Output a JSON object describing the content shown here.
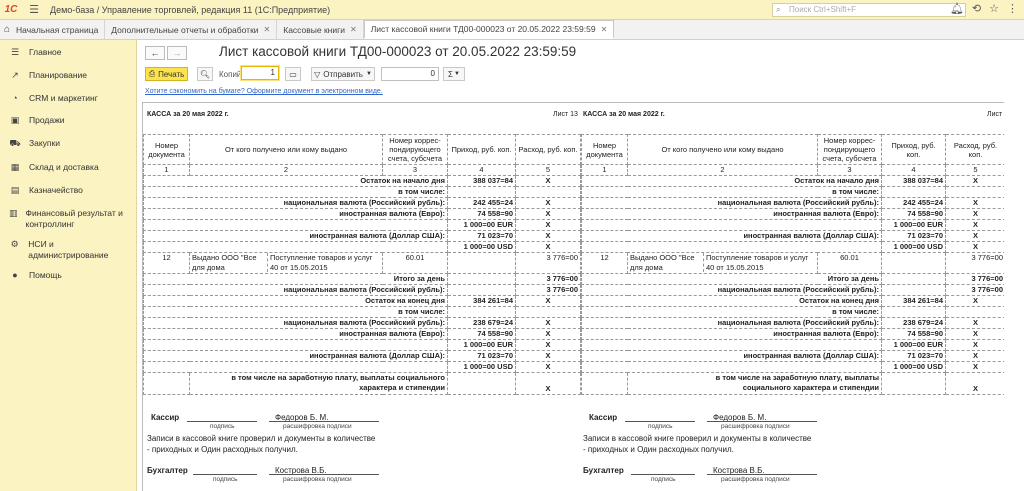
{
  "app": {
    "logo": "1С",
    "title": "Демо-база / Управление торговлей, редакция 11  (1С:Предприятие)",
    "search_placeholder": "Поиск Ctrl+Shift+F"
  },
  "tabs": [
    {
      "label": "Начальная страница"
    },
    {
      "label": "Дополнительные отчеты и обработки"
    },
    {
      "label": "Кассовые книги"
    },
    {
      "label": "Лист кассовой книги ТД00-000023 от 20.05.2022 23:59:59"
    }
  ],
  "sidebar": {
    "items": [
      {
        "label": "Главное",
        "icon": "menu-icon"
      },
      {
        "label": "Планирование",
        "icon": "chart-icon"
      },
      {
        "label": "CRM и маркетинг",
        "icon": "crm-icon"
      },
      {
        "label": "Продажи",
        "icon": "sales-icon"
      },
      {
        "label": "Закупки",
        "icon": "cart-icon"
      },
      {
        "label": "Склад и доставка",
        "icon": "warehouse-icon"
      },
      {
        "label": "Казначейство",
        "icon": "treasury-icon"
      },
      {
        "label": "Финансовый результат и контроллинг",
        "icon": "finance-icon"
      },
      {
        "label": "НСИ и администрирование",
        "icon": "gear-icon"
      },
      {
        "label": "Помощь",
        "icon": "help-icon"
      }
    ]
  },
  "document": {
    "title": "Лист кассовой книги ТД00-000023 от 20.05.2022 23:59:59",
    "print_label": "Печать",
    "copies_label": "Копий:",
    "copies_value": "1",
    "send_label": "Отправить",
    "sum_value": "0",
    "sigma_label": "Σ",
    "eco_link": "Хотите сэкономить на бумаге? Оформите документ в электронном виде."
  },
  "report": {
    "header_left": "КАССА за 20 мая 2022 г.",
    "header_right": "Лист 13",
    "columns": {
      "num": "Номер документа",
      "who": "От кого получено или кому выдано",
      "acc": "Номер коррес-пондирующего счета, субсчета",
      "in": "Приход, руб. коп.",
      "out": "Расход, руб. коп."
    },
    "col_numbers": [
      "1",
      "2",
      "3",
      "4",
      "5"
    ],
    "rows": {
      "open": "Остаток на начало дня",
      "open_in": "388 037=84",
      "including": "в том числе:",
      "nat": "национальная валюта (Российский рубль):",
      "open_nat": "242 455=24",
      "eur": "иностранная валюта (Евро):",
      "open_eur1": "74 558=90",
      "open_eur2": "1 000=00 EUR",
      "usd": "иностранная валюта (Доллар США):",
      "open_usd1": "71 023=70",
      "open_usd2": "1 000=00 USD",
      "doc_num": "12",
      "doc_who": "Выдано ООО \"Все для дома",
      "doc_basis": "Поступление товаров и услуг 40 от 15.05.2015",
      "doc_acc": "60.01",
      "doc_out": "3 776=00",
      "day_total": "Итого за день",
      "day_out": "3 776=00",
      "day_nat_out": "3 776=00",
      "close": "Остаток на конец  дня",
      "close_in": "384 261=84",
      "close_nat": "238 679=24",
      "close_eur1": "74 558=90",
      "close_eur2": "1 000=00 EUR",
      "close_usd1": "71 023=70",
      "close_usd2": "1 000=00 USD",
      "salary": "в том числе на заработную плату, выплаты социального характера и стипендии",
      "x": "X"
    },
    "signatures": {
      "cashier": "Кассир",
      "cashier_name": "Федоров Б. М.",
      "sign_caption": "подпись",
      "decode_caption": "расшифровка подписи",
      "checked": "Записи в кассовой книге проверил и документы в количестве",
      "checked2": " - приходных и Один расходных получил.",
      "accountant": "Бухгалтер",
      "accountant_name": "Кострова В.Б."
    }
  }
}
